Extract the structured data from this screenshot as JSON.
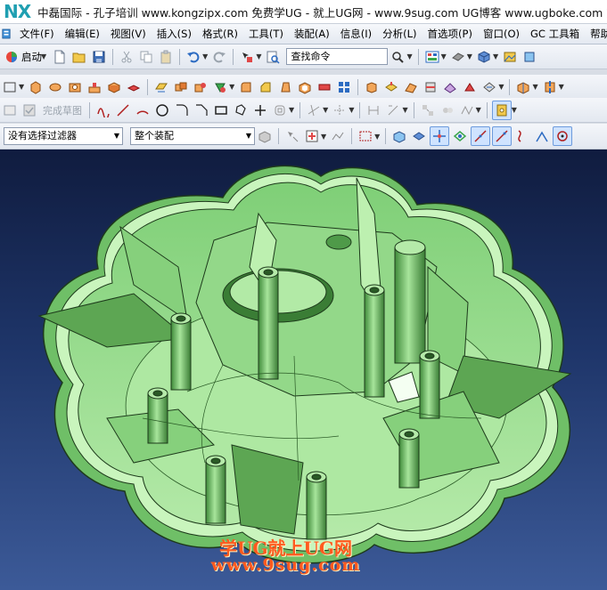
{
  "titlebar": {
    "logo": "NX",
    "title": "中磊国际 - 孔子培训 www.kongzipx.com 免费学UG - 就上UG网 - www.9sug.com  UG博客 www.ugboke.com 刘磊"
  },
  "menu": {
    "items": [
      {
        "label": "文件(F)"
      },
      {
        "label": "编辑(E)"
      },
      {
        "label": "视图(V)"
      },
      {
        "label": "插入(S)"
      },
      {
        "label": "格式(R)"
      },
      {
        "label": "工具(T)"
      },
      {
        "label": "装配(A)"
      },
      {
        "label": "信息(I)"
      },
      {
        "label": "分析(L)"
      },
      {
        "label": "首选项(P)"
      },
      {
        "label": "窗口(O)"
      },
      {
        "label": "GC 工具箱"
      },
      {
        "label": "帮助(H)"
      }
    ]
  },
  "toolbar1": {
    "start_label": "启动",
    "search_value": "查找命令"
  },
  "toolbar3": {
    "sketch_label": "完成草图"
  },
  "toolbar4": {
    "filter_value": "没有选择过滤器",
    "scope_value": "整个装配"
  },
  "watermark": {
    "line1": "学UG就上UG网",
    "line2": "www.9sug.com"
  },
  "colors": {
    "part_face": "#a4e59a",
    "part_dark": "#4f9a49",
    "part_edge": "#1d3a1b",
    "viewport_top": "#101c3f",
    "viewport_bottom": "#3c5a98",
    "watermark": "#ff5a1f"
  }
}
